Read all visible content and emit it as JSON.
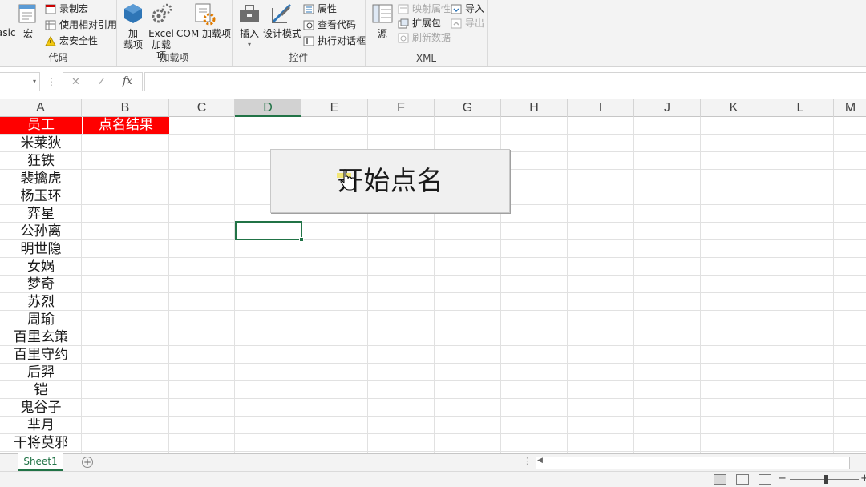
{
  "ribbon": {
    "code_group": {
      "title": "代码",
      "visual_basic_partial": "asic",
      "macros": "宏",
      "record_macro": "录制宏",
      "relative_refs": "使用相对引用",
      "macro_security": "宏安全性"
    },
    "addins_group": {
      "title": "加载项",
      "addins_line1": "加",
      "addins_line2": "载项",
      "excel_addins_line1": "Excel",
      "excel_addins_line2": "加载项",
      "com_addins": "COM 加载项"
    },
    "controls_group": {
      "title": "控件",
      "insert": "插入",
      "design_mode": "设计模式",
      "properties": "属性",
      "view_code": "查看代码",
      "run_dialog": "执行对话框"
    },
    "xml_group": {
      "title": "XML",
      "source": "源",
      "map_properties": "映射属性",
      "expansion_packs": "扩展包",
      "refresh_data": "刷新数据",
      "import": "导入",
      "export": "导出"
    }
  },
  "formula_bar": {
    "cancel": "✕",
    "enter": "✓",
    "fx": "fx",
    "value": ""
  },
  "columns": [
    "A",
    "B",
    "C",
    "D",
    "E",
    "F",
    "G",
    "H",
    "I",
    "J",
    "K",
    "L",
    "M"
  ],
  "header_row": {
    "a": "员工",
    "b": "点名结果"
  },
  "employees": [
    "米莱狄",
    "狂铁",
    "裴擒虎",
    "杨玉环",
    "弈星",
    "公孙离",
    "明世隐",
    "女娲",
    "梦奇",
    "苏烈",
    "周瑜",
    "百里玄策",
    "百里守约",
    "后羿",
    "铠",
    "鬼谷子",
    "芈月",
    "干将莫邪"
  ],
  "control_button": {
    "label": "开始点名"
  },
  "sheet_tab": "Sheet1",
  "colors": {
    "accent": "#217346",
    "header_fill": "#ff0000",
    "header_text": "#ffffff"
  }
}
